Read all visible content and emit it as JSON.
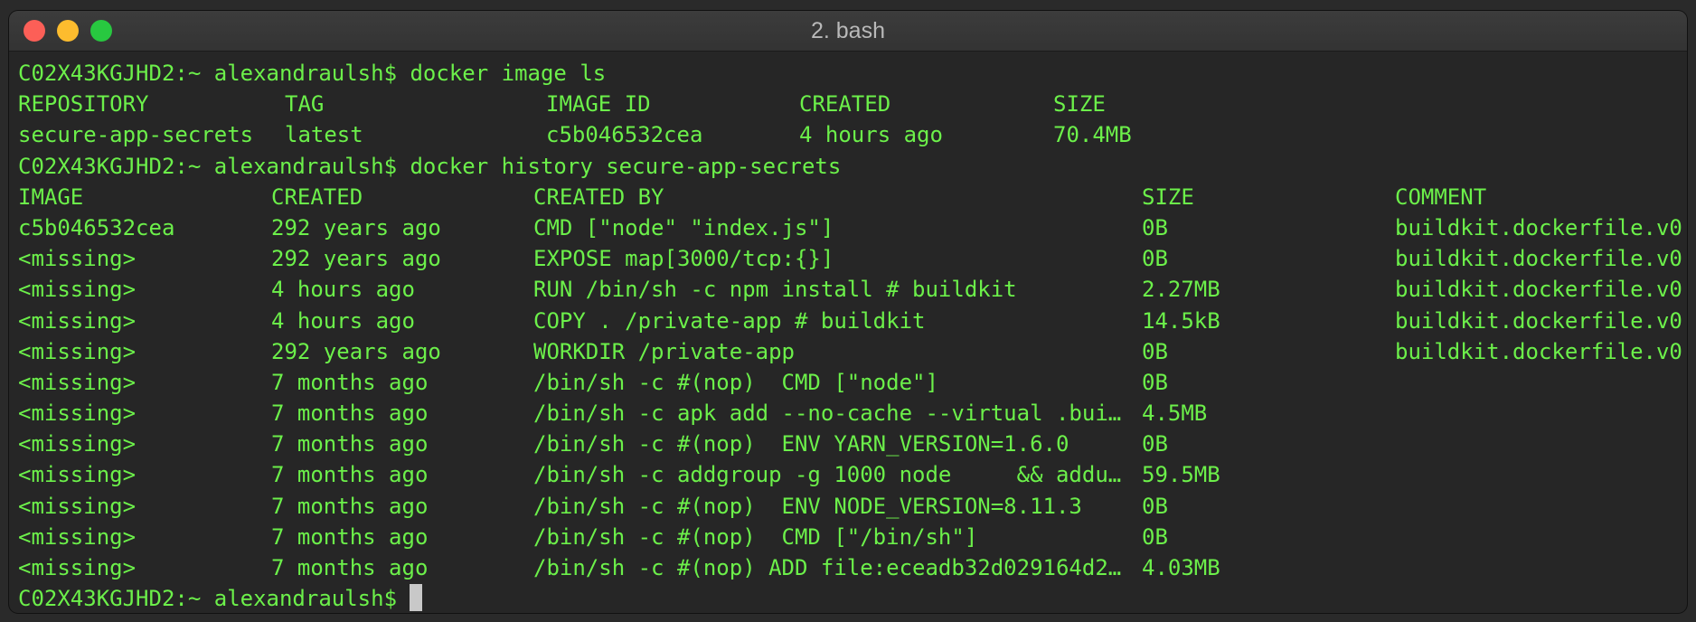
{
  "window": {
    "title": "2. bash"
  },
  "prompt": "C02X43KGJHD2:~ alexandraulsh$",
  "commands": {
    "image_ls": "docker image ls",
    "history": "docker history secure-app-secrets"
  },
  "image_ls": {
    "headers": [
      "REPOSITORY",
      "TAG",
      "IMAGE ID",
      "CREATED",
      "SIZE"
    ],
    "rows": [
      [
        "secure-app-secrets",
        "latest",
        "c5b046532cea",
        "4 hours ago",
        "70.4MB"
      ]
    ]
  },
  "history": {
    "headers": [
      "IMAGE",
      "CREATED",
      "CREATED BY",
      "SIZE",
      "COMMENT"
    ],
    "rows": [
      [
        "c5b046532cea",
        "292 years ago",
        "CMD [\"node\" \"index.js\"]",
        "0B",
        "buildkit.dockerfile.v0"
      ],
      [
        "<missing>",
        "292 years ago",
        "EXPOSE map[3000/tcp:{}]",
        "0B",
        "buildkit.dockerfile.v0"
      ],
      [
        "<missing>",
        "4 hours ago",
        "RUN /bin/sh -c npm install # buildkit",
        "2.27MB",
        "buildkit.dockerfile.v0"
      ],
      [
        "<missing>",
        "4 hours ago",
        "COPY . /private-app # buildkit",
        "14.5kB",
        "buildkit.dockerfile.v0"
      ],
      [
        "<missing>",
        "292 years ago",
        "WORKDIR /private-app",
        "0B",
        "buildkit.dockerfile.v0"
      ],
      [
        "<missing>",
        "7 months ago",
        "/bin/sh -c #(nop)  CMD [\"node\"]",
        "0B",
        ""
      ],
      [
        "<missing>",
        "7 months ago",
        "/bin/sh -c apk add --no-cache --virtual .bui…",
        "4.5MB",
        ""
      ],
      [
        "<missing>",
        "7 months ago",
        "/bin/sh -c #(nop)  ENV YARN_VERSION=1.6.0",
        "0B",
        ""
      ],
      [
        "<missing>",
        "7 months ago",
        "/bin/sh -c addgroup -g 1000 node     && addu…",
        "59.5MB",
        ""
      ],
      [
        "<missing>",
        "7 months ago",
        "/bin/sh -c #(nop)  ENV NODE_VERSION=8.11.3",
        "0B",
        ""
      ],
      [
        "<missing>",
        "7 months ago",
        "/bin/sh -c #(nop)  CMD [\"/bin/sh\"]",
        "0B",
        ""
      ],
      [
        "<missing>",
        "7 months ago",
        "/bin/sh -c #(nop) ADD file:eceadb32d029164d2…",
        "4.03MB",
        ""
      ]
    ]
  },
  "colors": {
    "terminal_text": "#6cf04a",
    "terminal_background": "#262626",
    "cursor": "#c8c8c8"
  }
}
